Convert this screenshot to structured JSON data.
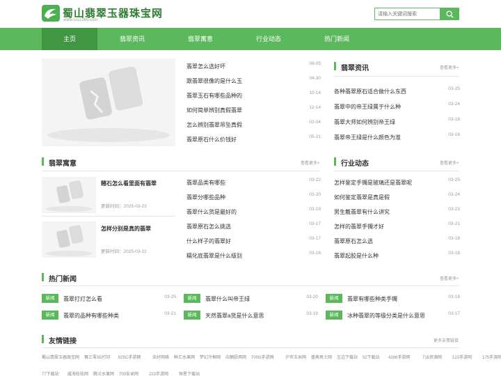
{
  "header": {
    "site_title": "蜀山翡翠玉器珠宝网",
    "site_url": "www.sscc365.com",
    "search_placeholder": "请输入关键词搜索"
  },
  "nav": [
    "主页",
    "翡翠资讯",
    "翡翠寓意",
    "行业动态",
    "热门新闻"
  ],
  "top_list": [
    {
      "t": "翡翠怎么选好坏",
      "d": "08-05"
    },
    {
      "t": "跟翡翠很像的是什么玉",
      "d": "04-30"
    },
    {
      "t": "翡翠玉石有哪些品种的",
      "d": "10-14"
    },
    {
      "t": "如何简单辨别真假翡翠",
      "d": "12-14"
    },
    {
      "t": "怎么辨别翡翠吊坠真假",
      "d": "02-04"
    },
    {
      "t": "翡翠原石什么价钱好",
      "d": "05-21"
    }
  ],
  "zixun": {
    "title": "翡翠资讯",
    "more": "查看更多+",
    "items": [
      {
        "t": "各种翡翠原石适合做什么东西",
        "d": "03-25"
      },
      {
        "t": "翡翠中的帝王绿属于什么种",
        "d": "03-24"
      },
      {
        "t": "翡翠大师如何辨别帝王绿",
        "d": "03-18"
      },
      {
        "t": "翡翠帝王绿是什么颜色为准",
        "d": "03-16"
      }
    ]
  },
  "yuyi": {
    "title": "翡翠寓意",
    "more": "查看更多+",
    "featured": [
      {
        "t": "赌石怎么看里面有翡翠",
        "time": "更新时间：2025-03-23"
      },
      {
        "t": "怎样分别是真的翡翠",
        "time": "更新时间：2025-03-22"
      }
    ],
    "items": [
      {
        "t": "翡翠品类有哪些",
        "d": "03-22"
      },
      {
        "t": "翡翠分哪些品种",
        "d": "03-20"
      },
      {
        "t": "翡翠什么货是最好的",
        "d": "03-19"
      },
      {
        "t": "翡翠原石怎么挑选",
        "d": "03-17"
      },
      {
        "t": "什么样子的翡翠好",
        "d": "03-17"
      },
      {
        "t": "糯化底翡翠是什么级别",
        "d": "03-16"
      }
    ]
  },
  "hangye": {
    "title": "行业动态",
    "more": "查看更多+",
    "items": [
      {
        "t": "怎样鉴定手镯是玻璃还是翡翠呢",
        "d": "03-25"
      },
      {
        "t": "如何鉴定翡翠是真是假",
        "d": "03-24"
      },
      {
        "t": "男生戴翡翠有什么讲究",
        "d": "03-23"
      },
      {
        "t": "怎样的翡翠手镯才好",
        "d": "03-21"
      },
      {
        "t": "翡翠原石怎么选",
        "d": "03-18"
      },
      {
        "t": "翡翠起胶是什么种",
        "d": "03-18"
      }
    ]
  },
  "hot": {
    "title": "热门新闻",
    "more": "查看更多+",
    "tag": "新闻",
    "items": [
      {
        "t": "翡翠打灯怎么看",
        "d": "03-25"
      },
      {
        "t": "翡翠什么叫帝王绿",
        "d": "03-20"
      },
      {
        "t": "翡翠有哪些种类手镯",
        "d": "03-18"
      },
      {
        "t": "翡翠的品种有哪些种类",
        "d": "03-21"
      },
      {
        "t": "天然翡翠a货是什么意思",
        "d": "03-19"
      },
      {
        "t": "冰种翡翠的等级分类是什么意思",
        "d": "03-17"
      }
    ]
  },
  "links": {
    "title": "友情链接",
    "more": "更多友情链接",
    "row1": [
      "蜀山翡翠玉器珠宝网",
      "舞三零3D打印",
      "925C手游网",
      "余好网络",
      "鲜汇水果网",
      "梦幻冷框网",
      "应酬厨具网",
      "700G手游网",
      "沪市玉米网",
      "盛典男士网",
      "左边下载站",
      "52下载站",
      "4166手游网",
      "716资源网",
      "123手游网",
      "175手游网"
    ],
    "row2": [
      "77下载站",
      "威海桂桂网",
      "腾汪水果网",
      "700安卓网",
      "223手游网",
      "恒星下载站"
    ]
  },
  "colors": {
    "accent": "#5cb85c",
    "nav_active": "#419641"
  }
}
